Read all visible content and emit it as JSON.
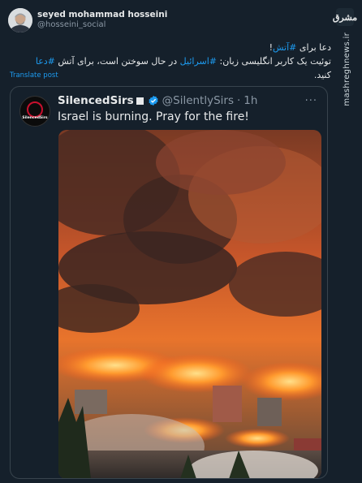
{
  "author": {
    "display_name": "seyed mohammad hosseini",
    "handle": "@hosseini_social"
  },
  "brand": {
    "logo_text": "مشرق",
    "url": "mashreghnews.ir"
  },
  "post": {
    "line1_prefix": "دعا برای ",
    "line1_hashtag": "#آتش",
    "line1_suffix": "!",
    "line2_a": "توئیت یک کاربر انگلیسی زبان: ",
    "line2_hashtag1": "#اسرائیل",
    "line2_b": " در حال سوختن است، برای آتش ",
    "line2_hashtag2": "#دعا",
    "line2_c": " کنید.",
    "translate_label": "Translate post"
  },
  "quote": {
    "avatar_text": "SilencedSirs",
    "display_name": "SilencedSirs",
    "handle": "@SilentlySirs",
    "separator": "·",
    "time": "1h",
    "more_label": "···",
    "text": "Israel is burning. Pray for the fire!",
    "image_alt": "wildfire-photo"
  },
  "colors": {
    "background": "#15202b",
    "accent": "#1d9bf0",
    "muted": "#8b98a5"
  }
}
